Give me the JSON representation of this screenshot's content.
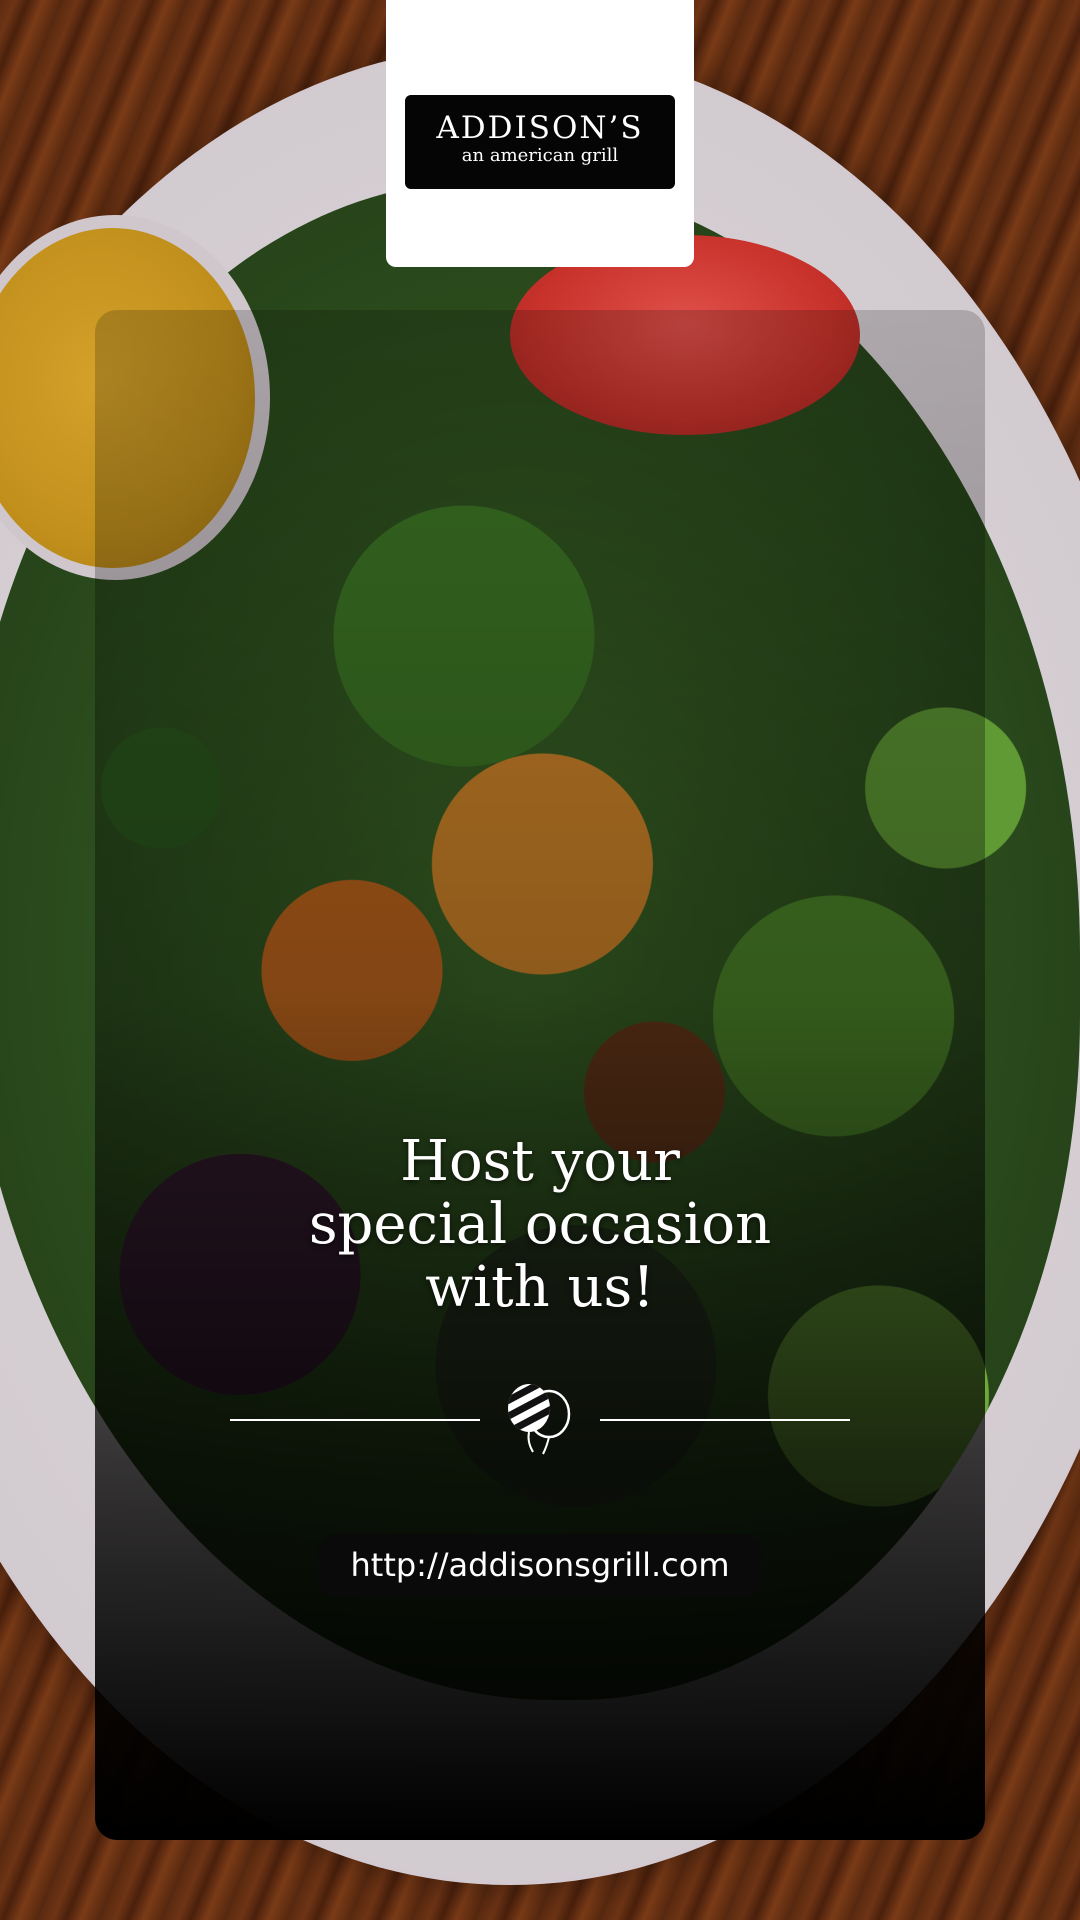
{
  "brand": {
    "name": "ADDISON’S",
    "tagline": "an american grill"
  },
  "promo": {
    "headline_line1": "Host your",
    "headline_line2": "special occasion",
    "headline_line3": "with us!"
  },
  "icons": {
    "divider": "balloons-icon"
  },
  "footer": {
    "url": "http://addisonsgrill.com"
  },
  "colors": {
    "panel_overlay": "#000000",
    "text": "#ffffff",
    "logo_card": "#ffffff",
    "logo_badge": "#050505"
  }
}
